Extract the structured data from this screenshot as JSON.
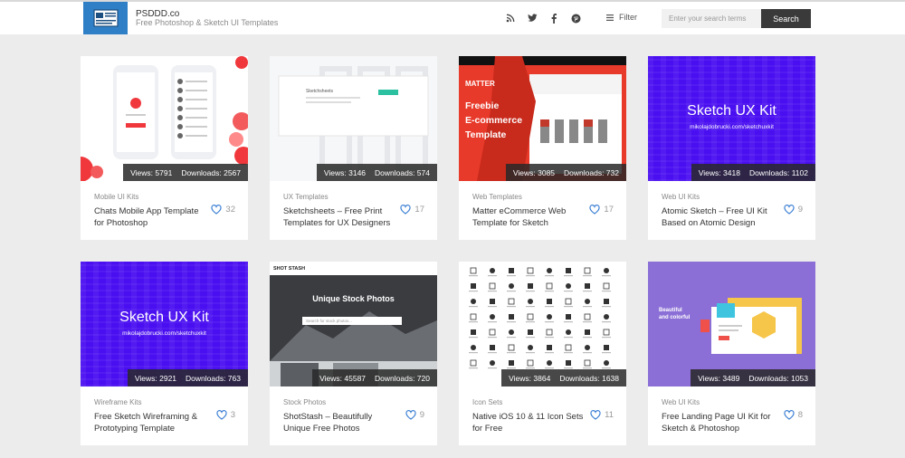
{
  "site": {
    "name": "PSDDD.co",
    "tagline": "Free Photoshop & Sketch UI Templates",
    "filter_label": "Filter",
    "search_placeholder": "Enter your search terms",
    "search_button": "Search",
    "social_icons": [
      "rss-icon",
      "twitter-icon",
      "facebook-icon",
      "pinterest-icon"
    ]
  },
  "cards": [
    {
      "category": "Mobile UI Kits",
      "title": "Chats Mobile App Template for Photoshop",
      "views": "Views: 5791",
      "downloads": "Downloads: 2567",
      "likes": "32"
    },
    {
      "category": "UX Templates",
      "title": "Sketchsheets – Free Print Templates for UX Designers",
      "views": "Views: 3146",
      "downloads": "Downloads: 574",
      "likes": "17"
    },
    {
      "category": "Web Templates",
      "title": "Matter eCommerce Web Template for Sketch",
      "views": "Views: 3085",
      "downloads": "Downloads: 732",
      "likes": "17",
      "thumb_text": [
        "MATTER",
        "Freebie",
        "E-commerce",
        "Template"
      ]
    },
    {
      "category": "Web UI Kits",
      "title": "Atomic Sketch – Free UI Kit Based on Atomic Design",
      "views": "Views: 3418",
      "downloads": "Downloads: 1102",
      "likes": "9",
      "thumb_text": [
        "Sketch UX Kit",
        "mikolajdobrucki.com/sketchuxkit"
      ]
    },
    {
      "category": "Wireframe Kits",
      "title": "Free Sketch Wireframing & Prototyping Template",
      "views": "Views: 2921",
      "downloads": "Downloads: 763",
      "likes": "3",
      "thumb_text": [
        "Sketch UX Kit",
        "mikolajdobrucki.com/sketchuxkit"
      ]
    },
    {
      "category": "Stock Photos",
      "title": "ShotStash – Beautifully Unique Free Photos",
      "views": "Views: 45587",
      "downloads": "Downloads: 720",
      "likes": "9",
      "thumb_text": [
        "SHOT STASH",
        "Unique Stock Photos",
        "Search for stock photos..."
      ]
    },
    {
      "category": "Icon Sets",
      "title": "Native iOS 10 & 11 Icon Sets for Free",
      "views": "Views: 3864",
      "downloads": "Downloads: 1638",
      "likes": "11"
    },
    {
      "category": "Web UI Kits",
      "title": "Free Landing Page UI Kit for Sketch & Photoshop",
      "views": "Views: 3489",
      "downloads": "Downloads: 1053",
      "likes": "8",
      "thumb_text": [
        "Beautiful",
        "and colorful"
      ]
    }
  ],
  "colors": {
    "accent": "#2f7fc6",
    "purple": "#4a0ff0",
    "lavender": "#8b6fd6",
    "heart": "#3b7fd4"
  }
}
